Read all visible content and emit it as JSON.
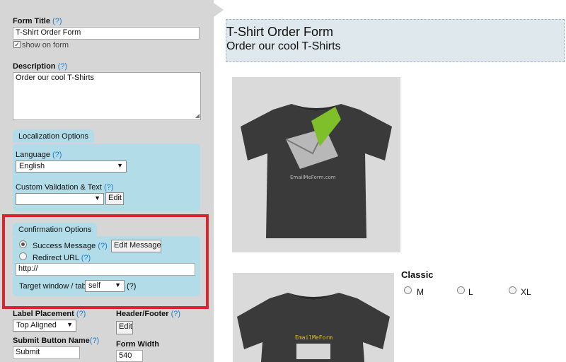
{
  "settings": {
    "form_title": {
      "label": "Form Title",
      "help": "(?)",
      "value": "T-Shirt Order Form",
      "show_on_form": "show on form"
    },
    "description": {
      "label": "Description",
      "help": "(?)",
      "value": "Order our cool T-Shirts"
    },
    "localization": {
      "title": "Localization Options",
      "language_label": "Language",
      "language_help": "(?)",
      "language_value": "English",
      "validation_label": "Custom Validation & Text",
      "validation_help": "(?)",
      "validation_value": "",
      "edit_label": "Edit"
    },
    "confirmation": {
      "title": "Confirmation Options",
      "success_label": "Success Message",
      "success_help": "(?)",
      "edit_message_label": "Edit Message",
      "redirect_label": "Redirect URL",
      "redirect_help": "(?)",
      "url_value": "http://",
      "target_label": "Target window / tab:",
      "target_value": "self",
      "target_help": "(?)"
    },
    "label_placement": {
      "label": "Label Placement",
      "help": "(?)",
      "value": "Top Aligned"
    },
    "header_footer": {
      "label": "Header/Footer",
      "help": "(?)",
      "edit_label": "Edit"
    },
    "submit_button": {
      "label": "Submit Button Name",
      "help": "(?)",
      "value": "Submit"
    },
    "form_width": {
      "label": "Form Width",
      "value": "540"
    }
  },
  "preview": {
    "title": "T-Shirt Order Form",
    "subtitle": "Order our cool T-Shirts",
    "shirt1_print": "EmailMeForm.com",
    "shirt2_print": "EmailMeForm",
    "product_label": "Classic",
    "sizes": [
      "M",
      "L",
      "XL"
    ]
  },
  "colors": {
    "panel_bg": "#d6d6d6",
    "option_box": "#b2dce8",
    "highlight": "#d9232d",
    "help_link": "#1a7fd0",
    "header_bg": "#dfe8ec"
  }
}
